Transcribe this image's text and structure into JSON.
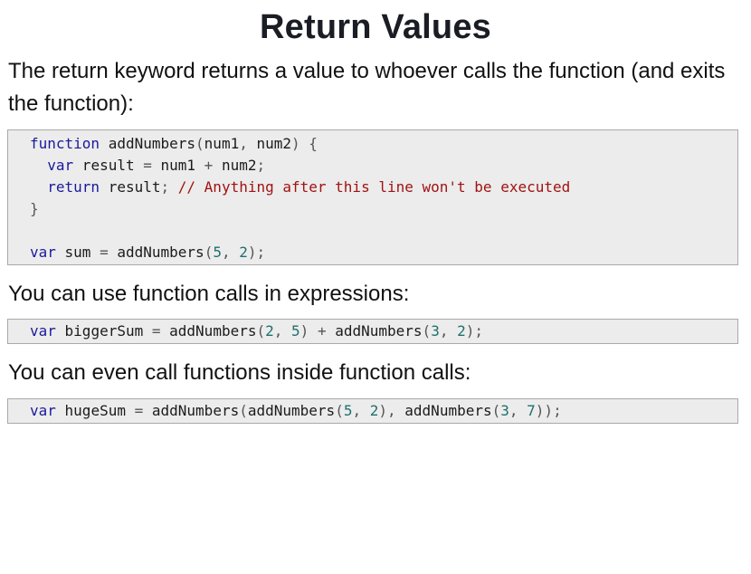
{
  "slide": {
    "title": "Return Values",
    "paragraphs": [
      "The return keyword returns a value to whoever calls the function (and exits the function):",
      "You can use function calls in expressions:",
      "You can even call functions inside function calls:"
    ]
  },
  "code1": {
    "l1": {
      "kw": "function",
      "name": " addNumbers",
      "p1": "(",
      "a1": "num1",
      "p2": ", ",
      "a2": "num2",
      "p3": ") {"
    },
    "l2": {
      "indent": "  ",
      "kw": "var",
      "name": " result ",
      "op1": "=",
      "a1": " num1 ",
      "op2": "+",
      "a2": " num2",
      "p1": ";"
    },
    "l3": {
      "indent": "  ",
      "kw": "return",
      "name": " result",
      "p1": ";",
      "cmt": " // Anything after this line won't be executed"
    },
    "l4": {
      "p1": "}"
    },
    "l5": {
      "text": ""
    },
    "l6": {
      "kw": "var",
      "name": " sum ",
      "op": "=",
      "fn": " addNumbers",
      "p1": "(",
      "n1": "5",
      "p2": ", ",
      "n2": "2",
      "p3": ");"
    }
  },
  "code2": {
    "kw": "var",
    "name": " biggerSum ",
    "op1": "=",
    "fn1": " addNumbers",
    "p1": "(",
    "n1": "2",
    "p2": ", ",
    "n2": "5",
    "p3": ")",
    "op2": " + ",
    "fn2": "addNumbers",
    "p4": "(",
    "n3": "3",
    "p5": ", ",
    "n4": "2",
    "p6": ");"
  },
  "code3": {
    "kw": "var",
    "name": " hugeSum ",
    "op1": "=",
    "fn1": " addNumbers",
    "p1": "(",
    "fn2": "addNumbers",
    "p2": "(",
    "n1": "5",
    "p3": ", ",
    "n2": "2",
    "p4": "), ",
    "fn3": "addNumbers",
    "p5": "(",
    "n3": "3",
    "p6": ", ",
    "n4": "7",
    "p7": "));"
  }
}
